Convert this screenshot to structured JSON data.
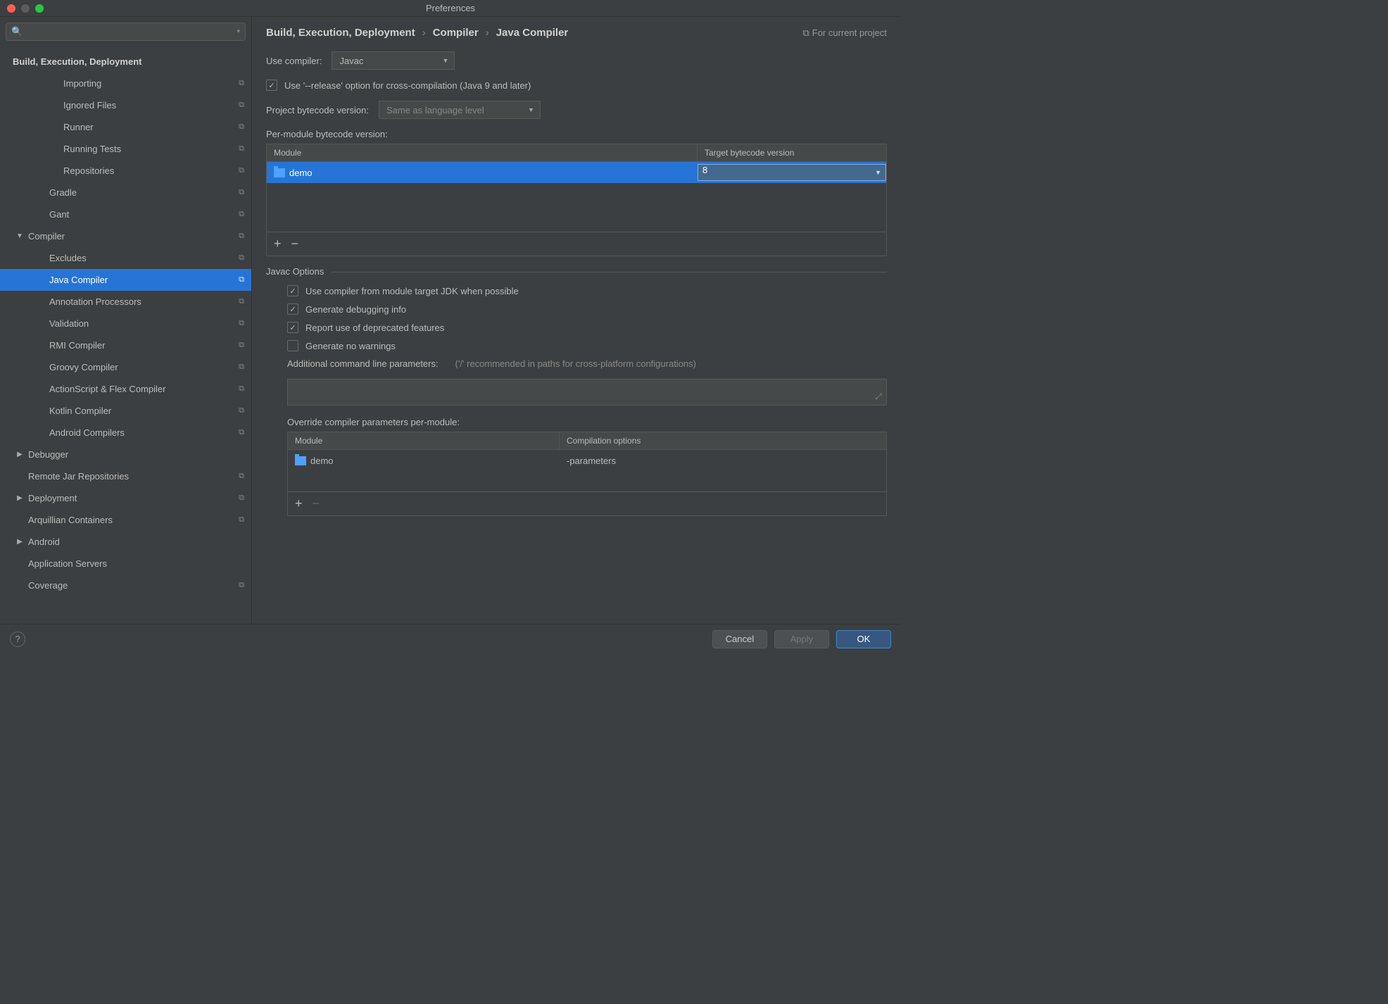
{
  "window_title": "Preferences",
  "breadcrumb": [
    "Build, Execution, Deployment",
    "Compiler",
    "Java Compiler"
  ],
  "for_current_project": "For current project",
  "sidebar": {
    "search_placeholder": "",
    "items": [
      {
        "label": "Build, Execution, Deployment",
        "level": 0,
        "bold": true,
        "proj": false
      },
      {
        "label": "Importing",
        "level": 3,
        "proj": true
      },
      {
        "label": "Ignored Files",
        "level": 3,
        "proj": true
      },
      {
        "label": "Runner",
        "level": 3,
        "proj": true
      },
      {
        "label": "Running Tests",
        "level": 3,
        "proj": true
      },
      {
        "label": "Repositories",
        "level": 3,
        "proj": true
      },
      {
        "label": "Gradle",
        "level": 2,
        "proj": true
      },
      {
        "label": "Gant",
        "level": 2,
        "proj": true
      },
      {
        "label": "Compiler",
        "level": 1,
        "proj": true,
        "arrow": "▼"
      },
      {
        "label": "Excludes",
        "level": 2,
        "proj": true
      },
      {
        "label": "Java Compiler",
        "level": 2,
        "proj": true,
        "selected": true
      },
      {
        "label": "Annotation Processors",
        "level": 2,
        "proj": true
      },
      {
        "label": "Validation",
        "level": 2,
        "proj": true
      },
      {
        "label": "RMI Compiler",
        "level": 2,
        "proj": true
      },
      {
        "label": "Groovy Compiler",
        "level": 2,
        "proj": true
      },
      {
        "label": "ActionScript & Flex Compiler",
        "level": 2,
        "proj": true
      },
      {
        "label": "Kotlin Compiler",
        "level": 2,
        "proj": true
      },
      {
        "label": "Android Compilers",
        "level": 2,
        "proj": true
      },
      {
        "label": "Debugger",
        "level": 1,
        "arrow": "▶"
      },
      {
        "label": "Remote Jar Repositories",
        "level": 1,
        "proj": true
      },
      {
        "label": "Deployment",
        "level": 1,
        "proj": true,
        "arrow": "▶"
      },
      {
        "label": "Arquillian Containers",
        "level": 1,
        "proj": true
      },
      {
        "label": "Android",
        "level": 1,
        "arrow": "▶"
      },
      {
        "label": "Application Servers",
        "level": 1
      },
      {
        "label": "Coverage",
        "level": 1,
        "proj": true
      }
    ]
  },
  "main": {
    "use_compiler_label": "Use compiler:",
    "use_compiler_value": "Javac",
    "release_option": "Use '--release' option for cross-compilation (Java 9 and later)",
    "project_bytecode_label": "Project bytecode version:",
    "project_bytecode_value": "Same as language level",
    "per_module_label": "Per-module bytecode version:",
    "table1": {
      "col_module": "Module",
      "col_target": "Target bytecode version",
      "row_module": "demo",
      "row_target": "8"
    },
    "javac_legend": "Javac Options",
    "javac_opts": [
      {
        "label": "Use compiler from module target JDK when possible",
        "checked": true
      },
      {
        "label": "Generate debugging info",
        "checked": true
      },
      {
        "label": "Report use of deprecated features",
        "checked": true
      },
      {
        "label": "Generate no warnings",
        "checked": false
      }
    ],
    "addl_params_label": "Additional command line parameters:",
    "addl_params_hint": "('/' recommended in paths for cross-platform configurations)",
    "override_label": "Override compiler parameters per-module:",
    "table2": {
      "col_module": "Module",
      "col_opts": "Compilation options",
      "row_module": "demo",
      "row_opts": "-parameters"
    }
  },
  "buttons": {
    "cancel": "Cancel",
    "apply": "Apply",
    "ok": "OK"
  }
}
